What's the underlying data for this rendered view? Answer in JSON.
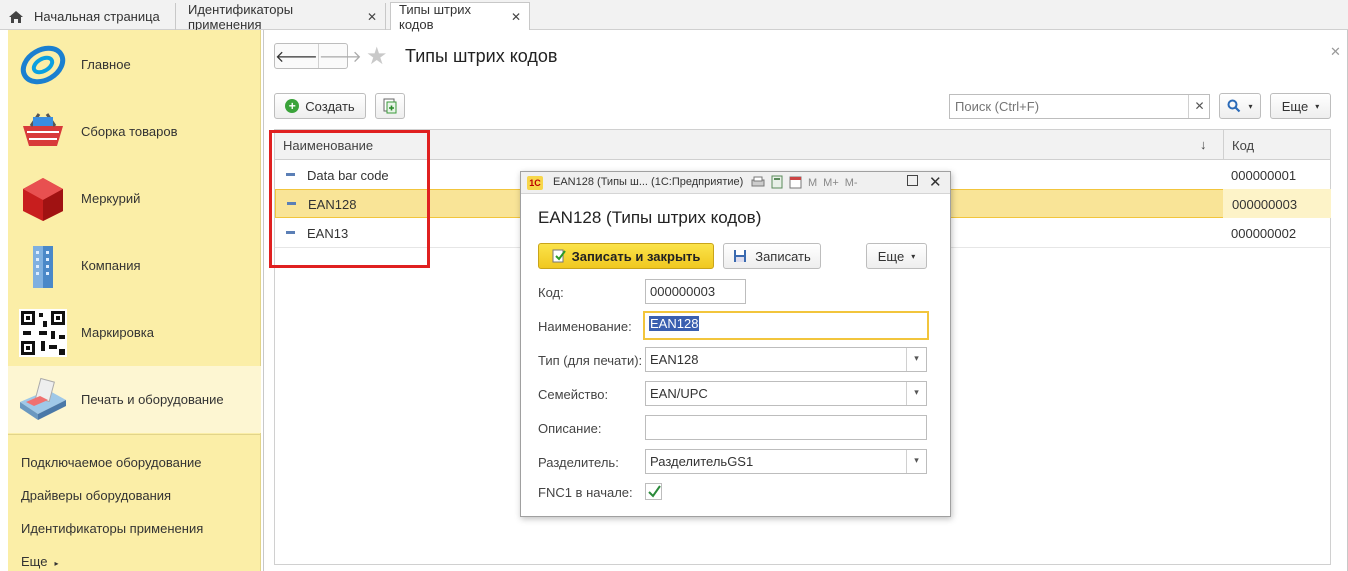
{
  "tabs": [
    {
      "label": "Начальная страница",
      "icon": "home-icon"
    },
    {
      "label": "Идентификаторы применения",
      "closable": true
    },
    {
      "label": "Типы штрих кодов",
      "closable": true,
      "active": true
    }
  ],
  "sidebar": {
    "sections": [
      {
        "label": "Главное",
        "icon": "main-logo-icon"
      },
      {
        "label": "Сборка товаров",
        "icon": "basket-icon"
      },
      {
        "label": "Меркурий",
        "icon": "cube-icon"
      },
      {
        "label": "Компания",
        "icon": "building-icon"
      },
      {
        "label": "Маркировка",
        "icon": "qr-code-icon"
      },
      {
        "label": "Печать и оборудование",
        "icon": "terminal-icon",
        "active": true
      }
    ],
    "links": [
      "Подключаемое оборудование",
      "Драйверы оборудования",
      "Идентификаторы применения"
    ],
    "more_label": "Еще"
  },
  "page": {
    "title": "Типы штрих кодов",
    "create_label": "Создать",
    "search_placeholder": "Поиск (Ctrl+F)",
    "more_label": "Еще"
  },
  "table": {
    "columns": [
      "Наименование",
      "Код"
    ],
    "sort_indicator": "↓",
    "rows": [
      {
        "name": "Data bar code",
        "code": "000000001"
      },
      {
        "name": "EAN128",
        "code": "000000003",
        "selected": true
      },
      {
        "name": "EAN13",
        "code": "000000002"
      }
    ]
  },
  "dialog": {
    "window_title": "EAN128 (Типы ш...   (1С:Предприятие)",
    "logo_text": "1С",
    "tools": [
      "M",
      "M+",
      "M-"
    ],
    "heading": "EAN128 (Типы штрих кодов)",
    "save_close_label": "Записать и закрыть",
    "save_label": "Записать",
    "more_label": "Еще",
    "fields": {
      "code": {
        "label": "Код:",
        "value": "000000003"
      },
      "name": {
        "label": "Наименование:",
        "value": "EAN128"
      },
      "print_type": {
        "label": "Тип (для печати):",
        "value": "EAN128"
      },
      "family": {
        "label": "Семейство:",
        "value": "EAN/UPC"
      },
      "description": {
        "label": "Описание:",
        "value": ""
      },
      "separator": {
        "label": "Разделитель:",
        "value": "РазделительGS1"
      },
      "fnc1": {
        "label": "FNC1 в начале:",
        "checked": true
      }
    }
  },
  "colors": {
    "sidebar_bg": "#fbeea7",
    "selection": "#f9e497",
    "accent_yellow": "#f2c53c",
    "annotation_red": "#e02020"
  }
}
